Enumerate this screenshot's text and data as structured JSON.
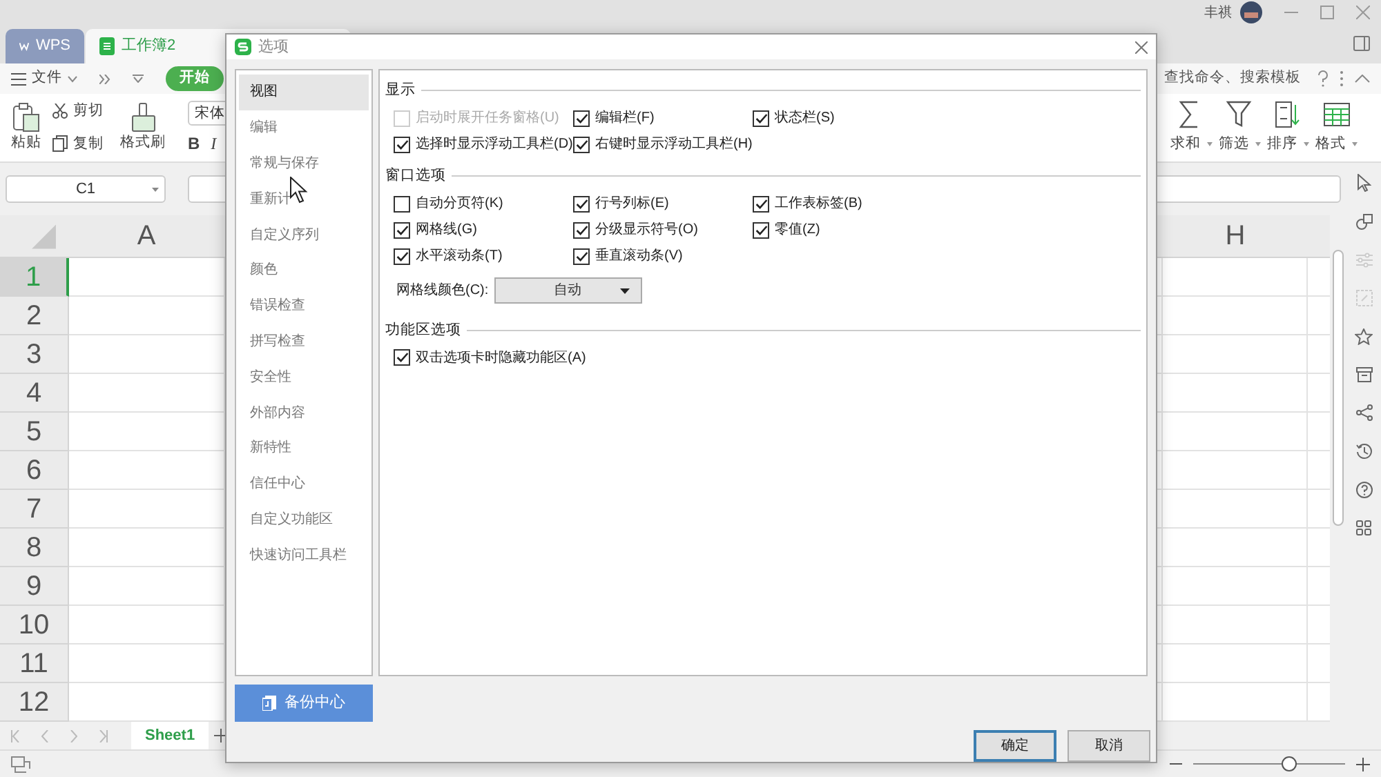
{
  "app_tabs": [
    {
      "label": "WPS",
      "kind": "home",
      "selected": false
    },
    {
      "label": "工作簿2",
      "kind": "workbook",
      "selected": true
    }
  ],
  "user": {
    "name": "丰祺"
  },
  "menu": {
    "file": "文件",
    "start_tab": "开始",
    "search_placeholder": "查找命令、搜索模板"
  },
  "ribbon_left": {
    "paste": "粘贴",
    "cut": "剪切",
    "copy": "复制",
    "format_painter": "格式刷",
    "font": "宋体",
    "bold": "B",
    "italic": "I"
  },
  "ribbon_right": [
    {
      "label": "求和",
      "kind": "sum"
    },
    {
      "label": "筛选",
      "kind": "filter"
    },
    {
      "label": "排序",
      "kind": "sort"
    },
    {
      "label": "格式",
      "kind": "format"
    }
  ],
  "name_box": "C1",
  "sheet": {
    "columns": [
      {
        "label": "A",
        "selected": false
      },
      {
        "label": "H",
        "selected": false
      }
    ],
    "rows": [
      {
        "label": "1",
        "selected": true
      },
      {
        "label": "2",
        "selected": false
      },
      {
        "label": "3",
        "selected": false
      },
      {
        "label": "4",
        "selected": false
      },
      {
        "label": "5",
        "selected": false
      },
      {
        "label": "6",
        "selected": false
      },
      {
        "label": "7",
        "selected": false
      },
      {
        "label": "8",
        "selected": false
      },
      {
        "label": "9",
        "selected": false
      },
      {
        "label": "10",
        "selected": false
      },
      {
        "label": "11",
        "selected": false
      },
      {
        "label": "12",
        "selected": false
      }
    ]
  },
  "sheet_tabs": [
    {
      "label": "Sheet1",
      "selected": true
    }
  ],
  "zoom": {
    "level": 0.63
  },
  "dialog": {
    "title": "选项",
    "nav": [
      {
        "label": "视图",
        "selected": true
      },
      {
        "label": "编辑",
        "selected": false
      },
      {
        "label": "常规与保存",
        "selected": false
      },
      {
        "label": "重新计",
        "selected": false
      },
      {
        "label": "自定义序列",
        "selected": false
      },
      {
        "label": "颜色",
        "selected": false
      },
      {
        "label": "错误检查",
        "selected": false
      },
      {
        "label": "拼写检查",
        "selected": false
      },
      {
        "label": "安全性",
        "selected": false
      },
      {
        "label": "外部内容",
        "selected": false
      },
      {
        "label": "新特性",
        "selected": false
      },
      {
        "label": "信任中心",
        "selected": false
      },
      {
        "label": "自定义功能区",
        "selected": false
      },
      {
        "label": "快速访问工具栏",
        "selected": false
      }
    ],
    "backup_button": "备份中心",
    "sections": [
      {
        "title": "显示",
        "options": [
          {
            "label": "启动时展开任务窗格(U)",
            "checked": false,
            "disabled": true
          },
          {
            "label": "编辑栏(F)",
            "checked": true,
            "disabled": false
          },
          {
            "label": "状态栏(S)",
            "checked": true,
            "disabled": false
          },
          {
            "label": "选择时显示浮动工具栏(D)",
            "checked": true,
            "disabled": false
          },
          {
            "label": "右键时显示浮动工具栏(H)",
            "checked": true,
            "disabled": false
          }
        ]
      },
      {
        "title": "窗口选项",
        "options": [
          {
            "label": "自动分页符(K)",
            "checked": false,
            "disabled": false
          },
          {
            "label": "行号列标(E)",
            "checked": true,
            "disabled": false
          },
          {
            "label": "工作表标签(B)",
            "checked": true,
            "disabled": false
          },
          {
            "label": "网格线(G)",
            "checked": true,
            "disabled": false
          },
          {
            "label": "分级显示符号(O)",
            "checked": true,
            "disabled": false
          },
          {
            "label": "零值(Z)",
            "checked": true,
            "disabled": false
          },
          {
            "label": "水平滚动条(T)",
            "checked": true,
            "disabled": false
          },
          {
            "label": "垂直滚动条(V)",
            "checked": true,
            "disabled": false
          }
        ],
        "select": {
          "label": "网格线颜色(C):",
          "value": "自动"
        }
      },
      {
        "title": "功能区选项",
        "options": [
          {
            "label": "双击选项卡时隐藏功能区(A)",
            "checked": true,
            "disabled": false
          }
        ]
      }
    ],
    "buttons": [
      {
        "label": "确定",
        "kind": "primary"
      },
      {
        "label": "取消",
        "kind": "secondary"
      }
    ]
  }
}
